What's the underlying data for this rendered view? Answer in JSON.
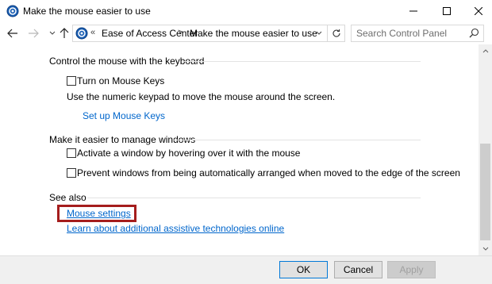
{
  "window": {
    "title": "Make the mouse easier to use"
  },
  "address_bar": {
    "chevrons": "«",
    "breadcrumbs": [
      "Ease of Access Center",
      "Make the mouse easier to use"
    ],
    "separator": ">"
  },
  "search": {
    "placeholder": "Search Control Panel"
  },
  "sections": {
    "keyboard": {
      "title": "Control the mouse with the keyboard",
      "mouse_keys_label": "Turn on Mouse Keys",
      "mouse_keys_checked": false,
      "description": "Use the numeric keypad to move the mouse around the screen.",
      "setup_link": "Set up Mouse Keys"
    },
    "windows": {
      "title": "Make it easier to manage windows",
      "hover_label": "Activate a window by hovering over it with the mouse",
      "hover_checked": false,
      "arrange_label": "Prevent windows from being automatically arranged when moved to the edge of the screen",
      "arrange_checked": false
    },
    "see_also": {
      "title": "See also",
      "links": [
        "Mouse settings",
        "Learn about additional assistive technologies online"
      ]
    }
  },
  "buttons": {
    "ok": "OK",
    "cancel": "Cancel",
    "apply": "Apply"
  },
  "colors": {
    "link": "#0066cc",
    "highlight_box": "#a51d1d",
    "accent": "#0078d7"
  }
}
